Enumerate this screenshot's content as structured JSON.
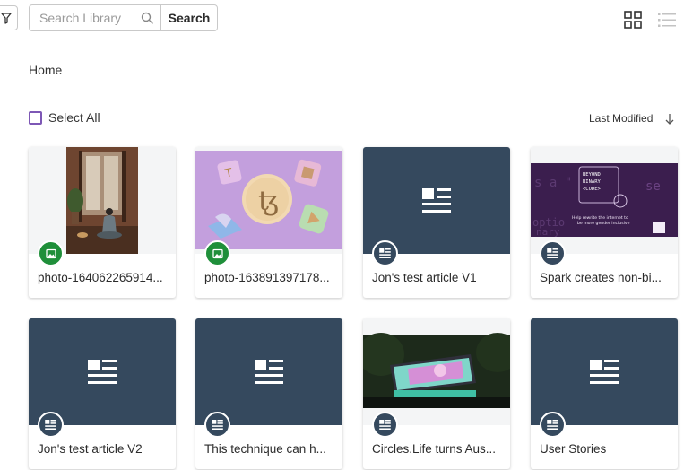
{
  "toolbar": {
    "search_placeholder": "Search Library",
    "search_label": "Search"
  },
  "breadcrumb": "Home",
  "select_all_label": "Select All",
  "sort_label": "Last Modified",
  "colors": {
    "accent_purple": "#7d57b5",
    "card_dark": "#35495e",
    "image_badge": "#1f8f3a"
  },
  "cards": [
    {
      "title": "photo-164062265914...",
      "type": "image"
    },
    {
      "title": "photo-163891397178...",
      "type": "image"
    },
    {
      "title": "Jon's test article V1",
      "type": "article"
    },
    {
      "title": "Spark creates non-bi...",
      "type": "article"
    },
    {
      "title": "Jon's test article V2",
      "type": "article"
    },
    {
      "title": "This technique can h...",
      "type": "article"
    },
    {
      "title": "Circles.Life turns Aus...",
      "type": "article"
    },
    {
      "title": "User Stories",
      "type": "article"
    }
  ],
  "card4_thumb": {
    "line1": "BEYOND",
    "line2": "BINARY",
    "line3": "<CODE>",
    "caption1": "Help rewrite the internet to",
    "caption2": "be more gender inclusive"
  },
  "icons": [
    "filter-icon",
    "search-icon",
    "grid-view-icon",
    "list-view-icon",
    "sort-down-icon",
    "image-icon",
    "article-icon"
  ]
}
